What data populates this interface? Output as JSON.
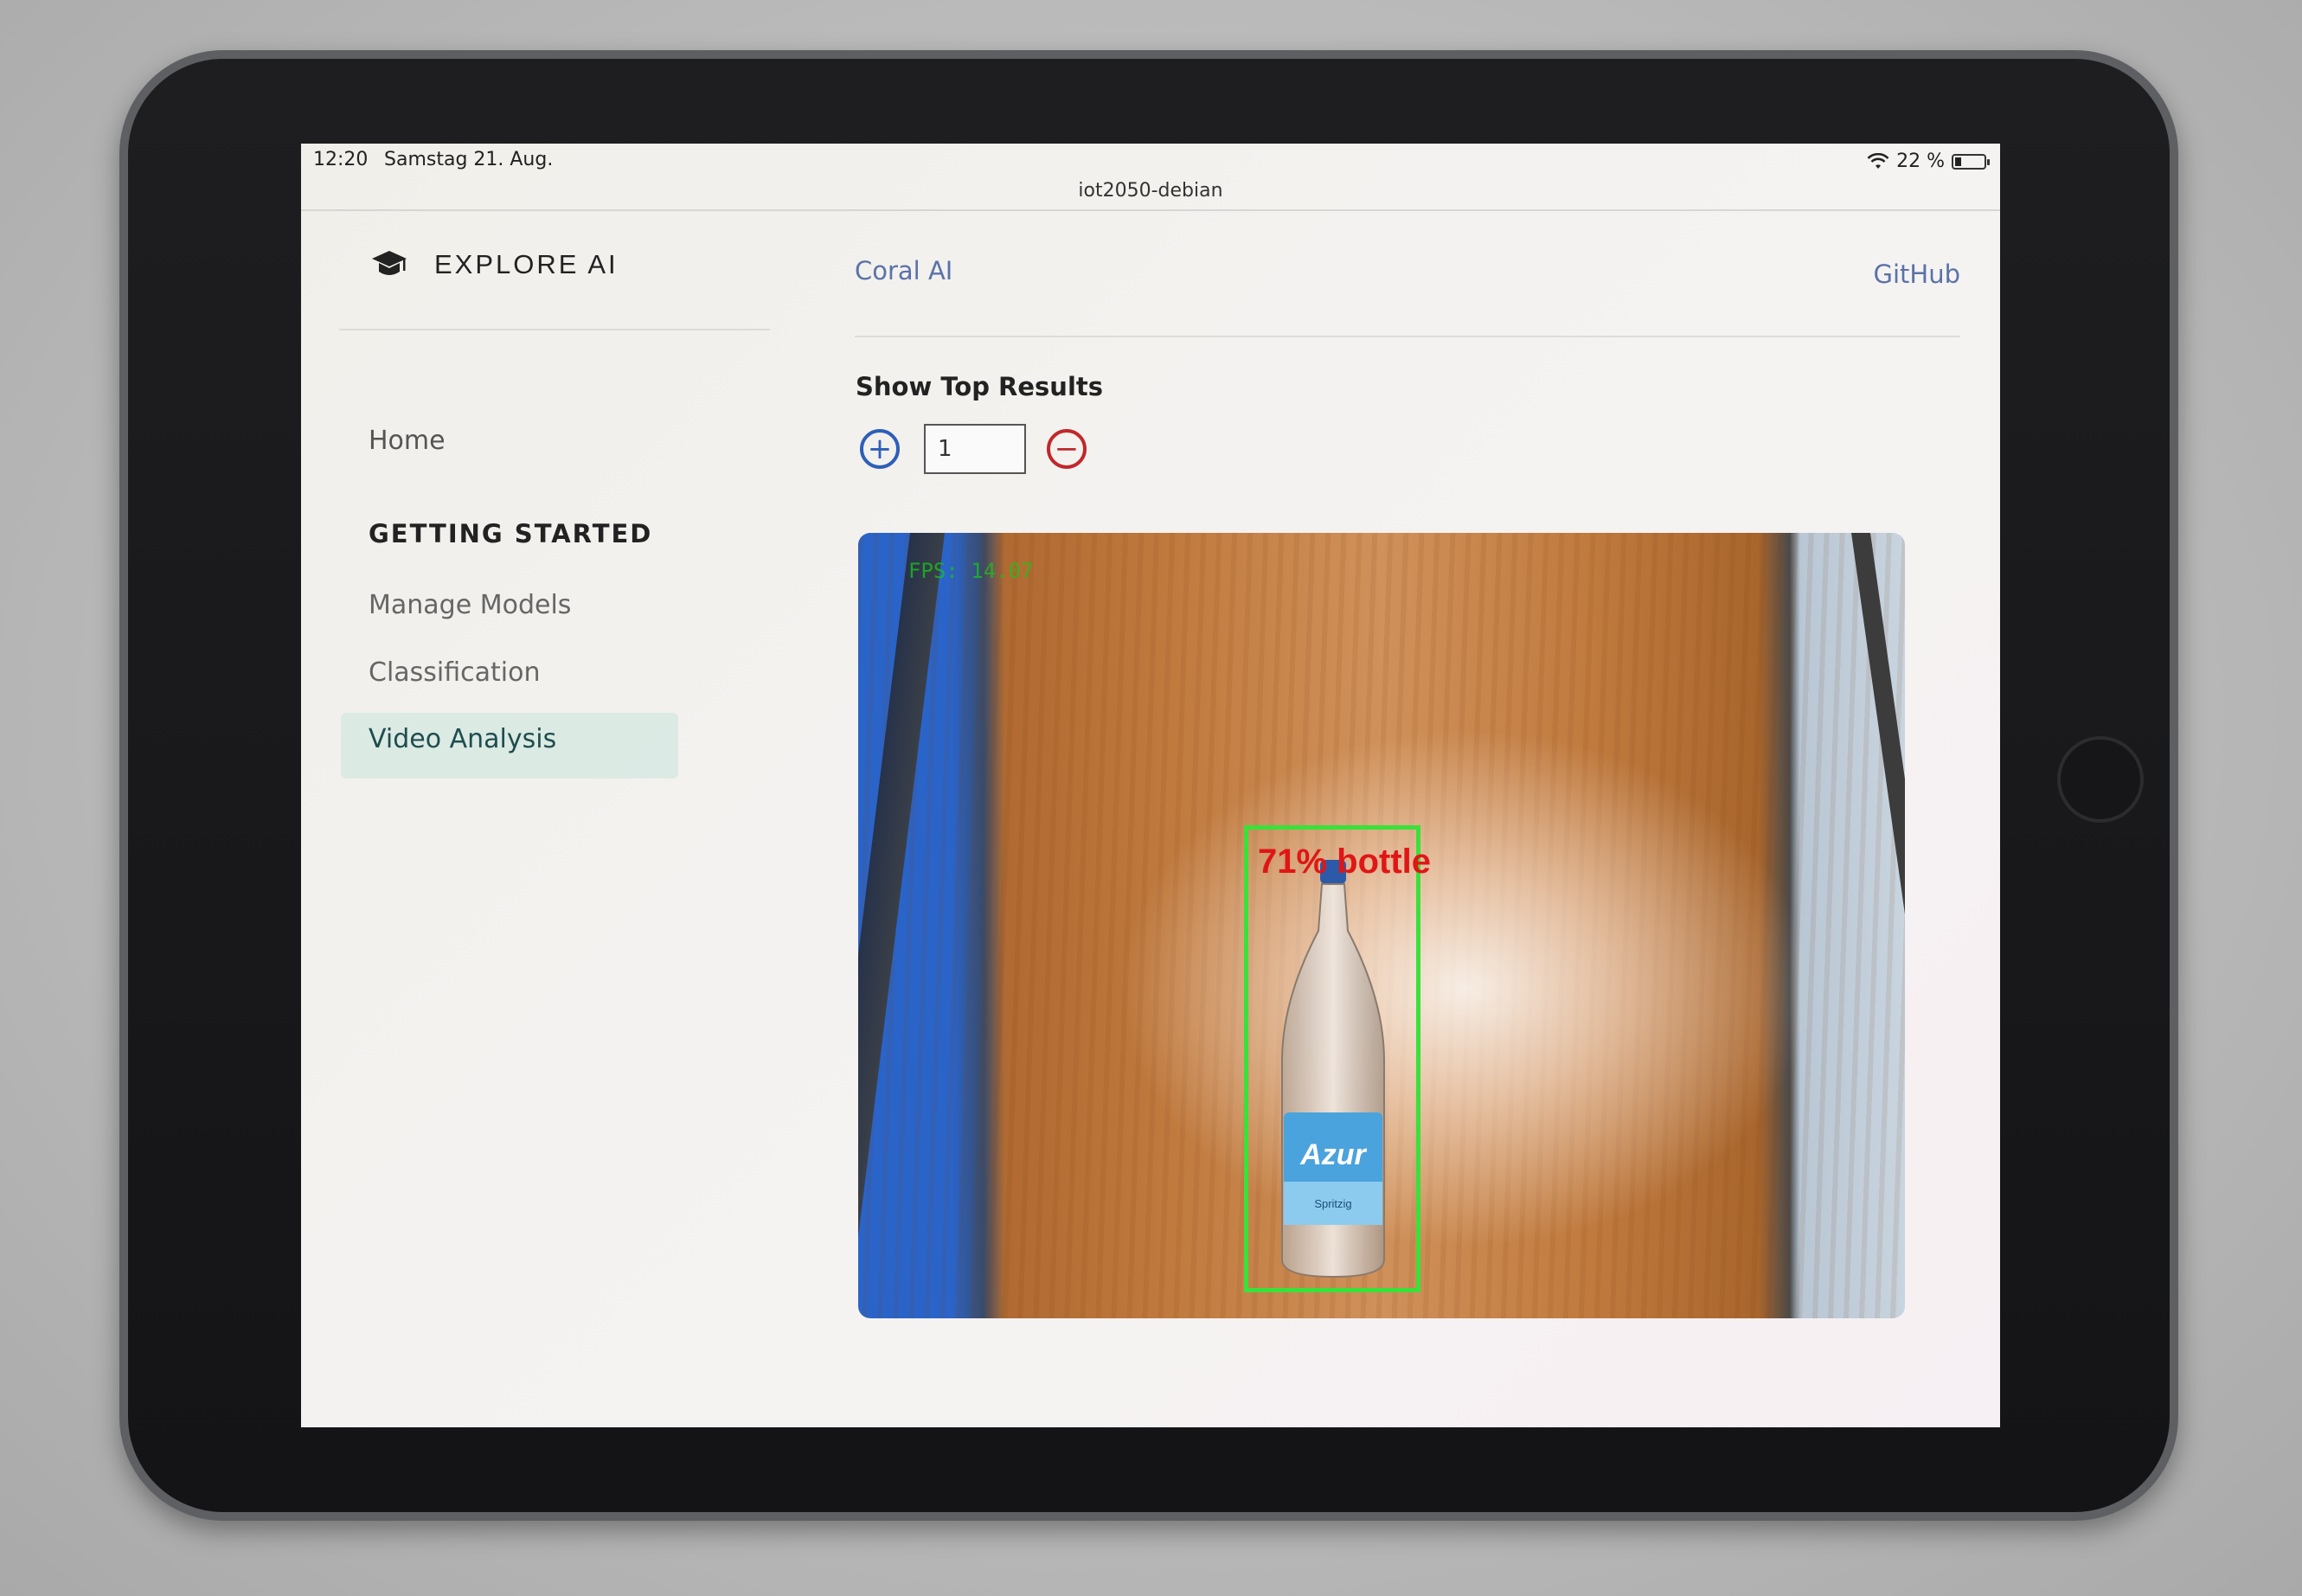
{
  "status_bar": {
    "time": "12:20",
    "date": "Samstag 21. Aug.",
    "battery": "22 %",
    "battery_level": 0.22
  },
  "url_bar": {
    "host": "iot2050-debian"
  },
  "sidebar": {
    "brand": "EXPLORE AI",
    "home": "Home",
    "section_heading": "GETTING STARTED",
    "items": [
      {
        "label": "Manage Models"
      },
      {
        "label": "Classification"
      },
      {
        "label": "Video Analysis",
        "active": true
      }
    ]
  },
  "top_nav": {
    "coral": "Coral AI",
    "github": "GitHub"
  },
  "controls": {
    "show_top_label": "Show Top Results",
    "plus": "+",
    "minus": "−",
    "count_value": "1"
  },
  "video": {
    "fps_overlay": "FPS: 14.07",
    "detection_label": "71% bottle",
    "box_color": "#39e13a",
    "label_color": "#e01616",
    "bottle_brand": "Azur",
    "bottle_sub": "Spritzig"
  },
  "colors": {
    "link": "#5a72a8",
    "plus": "#2e5fb8",
    "minus": "#c0282c",
    "active_bg": "#c8e4dc"
  }
}
